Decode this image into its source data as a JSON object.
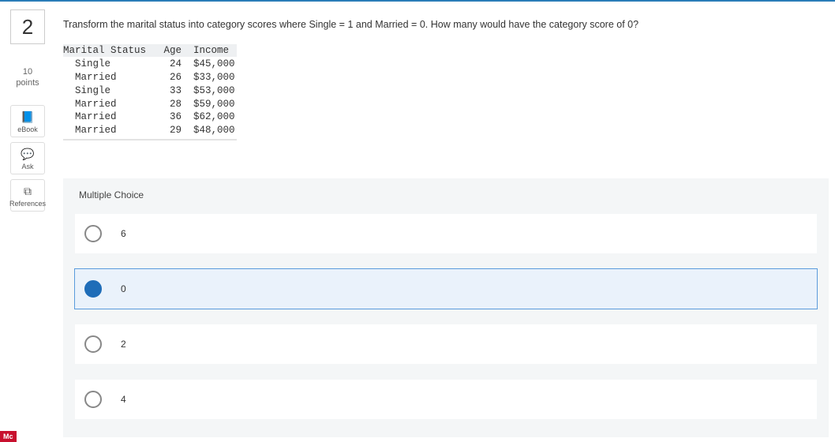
{
  "question": {
    "number": "2",
    "points_value": "10",
    "points_label": "points",
    "prompt": "Transform the marital status into category scores where Single = 1 and Married = 0. How many would have the category score of 0?"
  },
  "tools": {
    "ebook": "eBook",
    "ask": "Ask",
    "references": "References"
  },
  "table": {
    "header": "Marital Status   Age  Income",
    "rows": [
      "  Single          24  $45,000",
      "  Married         26  $33,000",
      "  Single          33  $53,000",
      "  Married         28  $59,000",
      "  Married         36  $62,000",
      "  Married         29  $48,000"
    ]
  },
  "mc": {
    "title": "Multiple Choice",
    "options": [
      "6",
      "0",
      "2",
      "4"
    ],
    "selected_index": 1
  },
  "brand": "Mc"
}
